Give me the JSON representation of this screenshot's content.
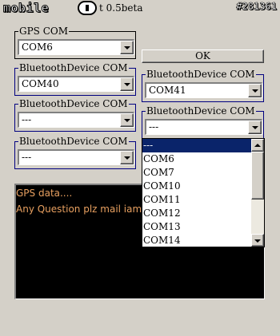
{
  "window": {
    "logo_text": "mobile",
    "title_suffix": "t 0.5beta",
    "watermark": "#281361"
  },
  "gps": {
    "label": "GPS COM",
    "value": "COM6"
  },
  "ok_label": "OK",
  "bt1": {
    "label": "BluetoothDevice COM",
    "value": "COM40"
  },
  "bt2": {
    "label": "BluetoothDevice COM",
    "value": "COM41"
  },
  "bt3": {
    "label": "BluetoothDevice COM",
    "value": "---"
  },
  "bt4": {
    "label": "BluetoothDevice COM",
    "value": "---"
  },
  "bt5": {
    "label": "BluetoothDevice COM",
    "value": "---"
  },
  "output": {
    "lines": [
      "GPS data....",
      "Any Question plz mail iam"
    ]
  },
  "dropdown": {
    "items": [
      "---",
      "COM6",
      "COM7",
      "COM10",
      "COM11",
      "COM12",
      "COM13",
      "COM14"
    ],
    "selected_index": 0
  },
  "colors": {
    "window_bg": "#d4d0c8",
    "group_border": "#000080",
    "output_text": "#e8a060",
    "selection": "#0a246a"
  }
}
